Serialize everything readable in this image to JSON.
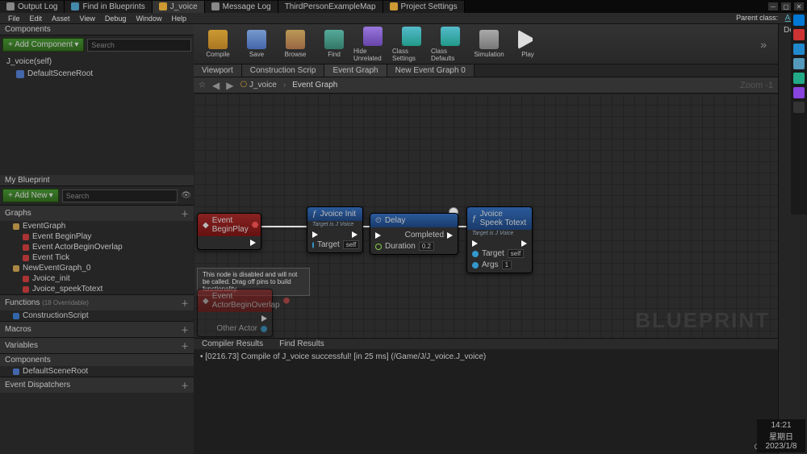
{
  "titleTabs": [
    {
      "label": "Output Log"
    },
    {
      "label": "Find in Blueprints"
    },
    {
      "label": "J_voice",
      "active": true
    },
    {
      "label": "Message Log"
    },
    {
      "label": "ThirdPersonExampleMap"
    },
    {
      "label": "Project Settings"
    }
  ],
  "menu": [
    "File",
    "Edit",
    "Asset",
    "View",
    "Debug",
    "Window",
    "Help"
  ],
  "parentClassLabel": "Parent class:",
  "parentClass": "Actor",
  "componentsPanel": {
    "title": "Components",
    "addBtn": "+ Add Component",
    "searchPlaceholder": "Search",
    "root": "J_voice(self)",
    "child": "DefaultSceneRoot"
  },
  "myBlueprint": {
    "title": "My Blueprint",
    "addNew": "+ Add New",
    "searchPlaceholder": "Search",
    "sections": {
      "graphs": "Graphs",
      "functions": "Functions",
      "functionsHint": "(18 Overridable)",
      "macros": "Macros",
      "variables": "Variables",
      "components": "Components",
      "dispatchers": "Event Dispatchers"
    },
    "graphItems": {
      "eventGraph": "EventGraph",
      "beginPlay": "Event BeginPlay",
      "actorOverlap": "Event ActorBeginOverlap",
      "tick": "Event Tick",
      "newGraph": "NewEventGraph_0",
      "jvoiceInit": "Jvoice_init",
      "jvoiceSpeek": "Jvoice_speekTotext"
    },
    "construction": "ConstructionScript",
    "defaultSceneRoot": "DefaultSceneRoot"
  },
  "toolbar": [
    {
      "name": "compile",
      "label": "Compile",
      "cls": "ic-compile"
    },
    {
      "name": "save",
      "label": "Save",
      "cls": "ic-save"
    },
    {
      "name": "browse",
      "label": "Browse",
      "cls": "ic-browse"
    },
    {
      "name": "find",
      "label": "Find",
      "cls": "ic-find"
    },
    {
      "name": "hide",
      "label": "Hide Unrelated",
      "cls": "ic-hide"
    },
    {
      "name": "classsettings",
      "label": "Class Settings",
      "cls": "ic-class"
    },
    {
      "name": "classdefaults",
      "label": "Class Defaults",
      "cls": "ic-default"
    },
    {
      "name": "simulation",
      "label": "Simulation",
      "cls": "ic-sim"
    },
    {
      "name": "play",
      "label": "Play",
      "cls": "ic-play"
    }
  ],
  "editorTabs": [
    {
      "label": "Viewport"
    },
    {
      "label": "Construction Scrip"
    },
    {
      "label": "Event Graph",
      "active": true
    },
    {
      "label": "New Event Graph 0"
    }
  ],
  "breadcrumb": {
    "blueprint": "J_voice",
    "graph": "Event Graph",
    "zoom": "Zoom -1"
  },
  "nodes": {
    "beginPlay": {
      "title": "Event BeginPlay"
    },
    "jvoiceInit": {
      "title": "Jvoice Init",
      "sub": "Target is J Voice",
      "targetLabel": "Target",
      "targetVal": "self"
    },
    "delay": {
      "title": "Delay",
      "durationLabel": "Duration",
      "durationVal": "0.2",
      "completedLabel": "Completed"
    },
    "speek": {
      "title": "Jvoice Speek Totext",
      "sub": "Target is J Voice",
      "targetLabel": "Target",
      "targetVal": "self",
      "argsLabel": "Args",
      "argsVal": "1"
    },
    "actorOverlap": {
      "title": "Event ActorBeginOverlap",
      "otherActor": "Other Actor"
    }
  },
  "disabledTooltip": "This node is disabled and will not be called. Drag off pins to build functionality.",
  "watermark": "BLUEPRINT",
  "bottomTabs": {
    "compiler": "Compiler Results",
    "find": "Find Results"
  },
  "compileMsg": "• [0216.73] Compile of J_voice successful! [in 25 ms] (/Game/J/J_voice.J_voice)",
  "clearBtn": "Clear",
  "detailsTitle": "Details",
  "clock": {
    "time": "14:21",
    "day": "星期日",
    "date": "2023/1/8"
  }
}
